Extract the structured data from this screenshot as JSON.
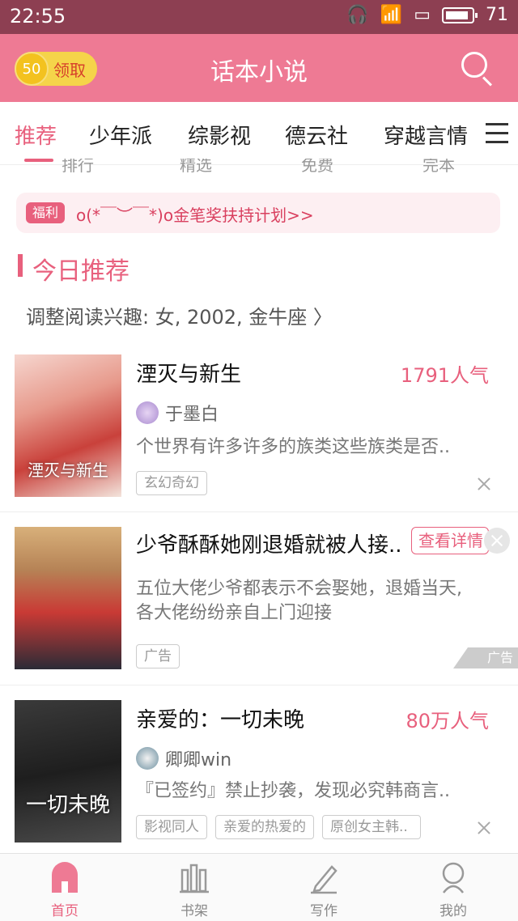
{
  "status_bar": {
    "time": "22:55",
    "battery": "71"
  },
  "app_bar": {
    "coin_count": "50",
    "coin_label": "领取",
    "title": "话本小说"
  },
  "tabs": [
    {
      "label": "推荐"
    },
    {
      "label": "少年派"
    },
    {
      "label": "综影视"
    },
    {
      "label": "德云社"
    },
    {
      "label": "穿越言情"
    }
  ],
  "partial_row": [
    "排行",
    "精选",
    "免费",
    "完本"
  ],
  "notice": {
    "tag": "福利",
    "text": "o(*￣︶￣*)o金笔奖扶持计划>>"
  },
  "section": {
    "title": "今日推荐"
  },
  "interest": {
    "text": "调整阅读兴趣: 女, 2002, 金牛座 〉"
  },
  "books": [
    {
      "title": "湮灭与新生",
      "popularity": "1791人气",
      "author": "于墨白",
      "description": "个世界有许多许多的族类这些族类是否..",
      "cover_text": "湮灭与新生",
      "tags": [
        "玄幻奇幻"
      ]
    },
    {
      "title": "少爷酥酥她刚退婚就被人接..",
      "details_label": "查看详情",
      "description_line1": "五位大佬少爷都表示不会娶她，退婚当天,",
      "description_line2": "各大佬纷纷亲自上门迎接",
      "tags": [
        "广告"
      ],
      "ad_corner": "广告"
    },
    {
      "title": "亲爱的：一切未晚",
      "popularity": "80万人气",
      "author": "卿卿win",
      "description": "『已签约』禁止抄袭，发现必究韩商言..",
      "cover_text": "一切未晚",
      "tags": [
        "影视同人",
        "亲爱的热爱的",
        "原创女主韩.."
      ]
    }
  ],
  "bottom_nav": [
    {
      "label": "首页"
    },
    {
      "label": "书架"
    },
    {
      "label": "写作"
    },
    {
      "label": "我的"
    }
  ],
  "colors": {
    "accent": "#e8607d",
    "app_bar": "#ee7a94",
    "status_bar": "#8d3f52"
  }
}
